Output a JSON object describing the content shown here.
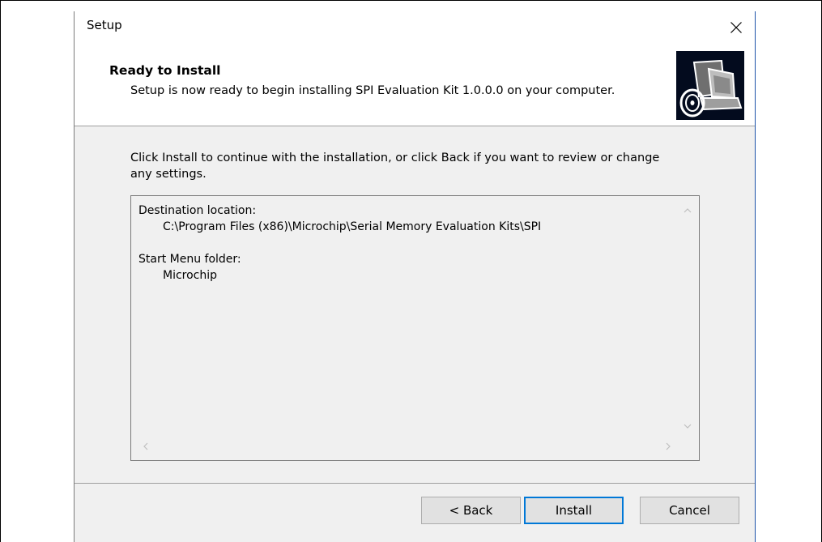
{
  "window": {
    "title": "Setup"
  },
  "header": {
    "title": "Ready to Install",
    "description": "Setup is now ready to begin installing SPI Evaluation Kit 1.0.0.0 on your computer.",
    "icon": "computer-setup-icon"
  },
  "body": {
    "instructions": "Click Install to continue with the installation, or click Back if you want to review or change any settings.",
    "memo": {
      "destination_label": "Destination location:",
      "destination_value": "C:\\Program Files (x86)\\Microchip\\Serial Memory Evaluation Kits\\SPI",
      "start_menu_label": "Start Menu folder:",
      "start_menu_value": "Microchip"
    }
  },
  "buttons": {
    "back": "< Back",
    "install": "Install",
    "cancel": "Cancel"
  },
  "colors": {
    "accent": "#0078d7",
    "panel": "#f0f0f0",
    "icon_bg": "#030b1e"
  }
}
